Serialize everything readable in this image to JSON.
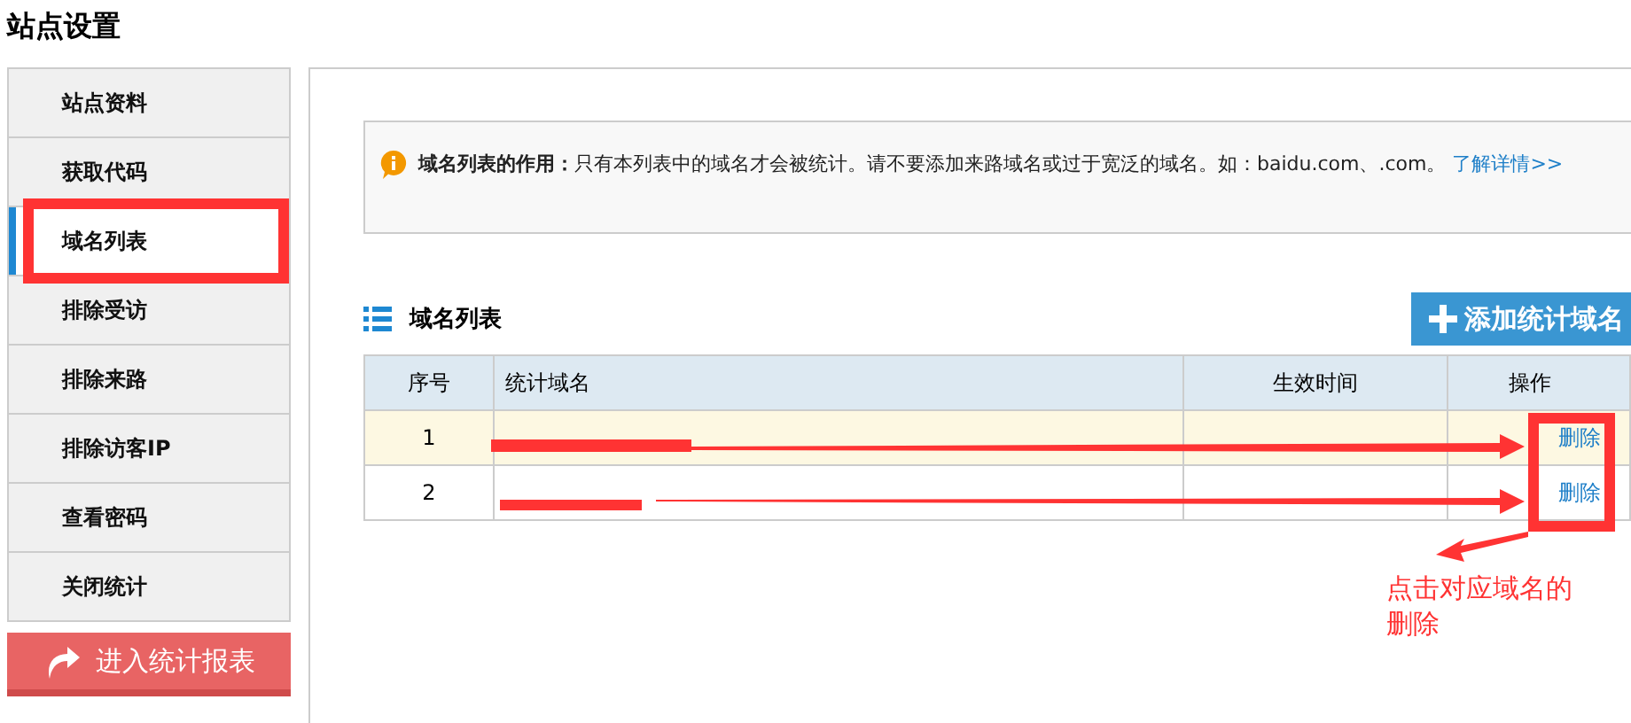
{
  "page_title": "站点设置",
  "sidebar": {
    "items": [
      {
        "label": "站点资料",
        "selected": false
      },
      {
        "label": "获取代码",
        "selected": false
      },
      {
        "label": "域名列表",
        "selected": true
      },
      {
        "label": "排除受访",
        "selected": false
      },
      {
        "label": "排除来路",
        "selected": false
      },
      {
        "label": "排除访客IP",
        "selected": false
      },
      {
        "label": "查看密码",
        "selected": false
      },
      {
        "label": "关闭统计",
        "selected": false
      }
    ],
    "report_button": "进入统计报表"
  },
  "notice": {
    "text": "**域名列表的作用：**只有本列表中的域名才会被统计。请不要添加来路域名或过于宽泛的域名。如：baidu.com、.com。",
    "link": "了解详情>>"
  },
  "section_title": "域名列表",
  "add_button": "添加统计域名",
  "table": {
    "columns": [
      "序号",
      "统计域名",
      "生效时间",
      "操作"
    ],
    "rows": [
      {
        "index": "1",
        "actions": [
          "删除"
        ]
      },
      {
        "index": "2",
        "actions": [
          "删除"
        ]
      }
    ]
  },
  "annotation": {
    "text": "点击对应域名的删除"
  }
}
